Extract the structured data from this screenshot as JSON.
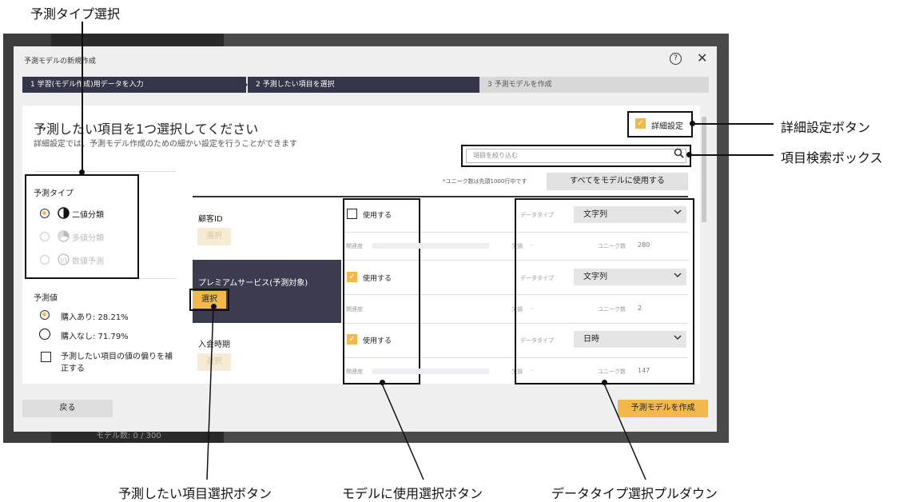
{
  "background": {
    "footer_text": "モデル数: 0 / 300"
  },
  "modal": {
    "title": "予測モデルの新規作成",
    "help_icon": "?",
    "close_icon": "✕",
    "steps": [
      {
        "label": "1 学習(モデル作成)用データを入力"
      },
      {
        "label": "2 予測したい項目を選択"
      },
      {
        "label": "3 予測モデルを作成"
      }
    ],
    "heading": "予測したい項目を1つ選択してください",
    "subheading": "詳細設定では、予測モデル作成のための細かい設定を行うことができます",
    "advanced_settings_label": "詳細設定",
    "search_placeholder": "項目を絞り込む",
    "unique_note": "*ユニーク数は先頭1000行中です",
    "use_all_button": "すべてをモデルに使用する",
    "prediction_type": {
      "title": "予測タイプ",
      "options": [
        {
          "label": "二値分類",
          "selected": true
        },
        {
          "label": "多値分類",
          "selected": false
        },
        {
          "label": "数値予測",
          "selected": false
        }
      ]
    },
    "prediction_value": {
      "title": "予測値",
      "options": [
        {
          "label": "購入あり: 28.21%",
          "selected": true
        },
        {
          "label": "購入なし: 71.79%",
          "selected": false
        }
      ],
      "correct_bias_label": "予測したい項目の値の偏りを補正する"
    },
    "items": [
      {
        "name": "顧客ID",
        "select_label": "選択",
        "use_label": "使用する",
        "use_checked": false,
        "datatype_label": "データタイプ",
        "datatype": "文字列",
        "relevance_label": "関連度",
        "missing_label": "欠損",
        "missing_value": "-",
        "unique_label": "ユニーク数",
        "unique_value": "280"
      },
      {
        "name": "プレミアムサービス(予測対象)",
        "select_label": "選択",
        "use_label": "使用する",
        "use_checked": true,
        "datatype_label": "データタイプ",
        "datatype": "文字列",
        "relevance_label": "関連度",
        "missing_label": "欠損",
        "missing_value": "-",
        "unique_label": "ユニーク数",
        "unique_value": "2"
      },
      {
        "name": "入会時期",
        "select_label": "選択",
        "use_label": "使用する",
        "use_checked": true,
        "datatype_label": "データタイプ",
        "datatype": "日時",
        "relevance_label": "関連度",
        "missing_label": "欠損",
        "missing_value": "-",
        "unique_label": "ユニーク数",
        "unique_value": "147"
      }
    ],
    "back_button": "戻る",
    "create_button": "予測モデルを作成"
  },
  "callouts": {
    "prediction_type_select": "予測タイプ選択",
    "advanced_settings_button": "詳細設定ボタン",
    "item_search_box": "項目検索ボックス",
    "target_select_button": "予測したい項目選択ボタン",
    "model_use_select_button": "モデルに使用選択ボタン",
    "datatype_pulldown": "データタイプ選択プルダウン"
  },
  "colors": {
    "accent": "#f2b84b",
    "step_active": "#343548",
    "selected_row": "#3b3c4f"
  }
}
